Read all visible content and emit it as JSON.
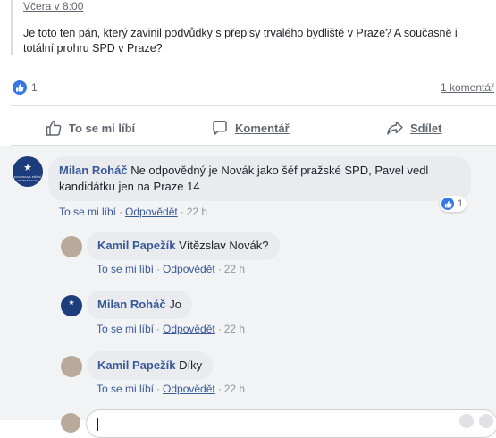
{
  "post": {
    "time": "Včera v 8:00",
    "text": "Je toto ten pán, který zavinil podvůdky s přepisy trvalého bydliště v Praze? A současně i totální prohru SPD v Praze?"
  },
  "reactions": {
    "likes": "1",
    "comments": "1 komentář"
  },
  "actions": {
    "like": "To se mi líbí",
    "comment": "Komentář",
    "share": "Sdílet"
  },
  "avatar_text": {
    "star": "★",
    "spd": "SVOBODA A PŘÍMÁ DEMOKRACIE"
  },
  "comments": [
    {
      "author": "Milan Roháč",
      "text": "Ne odpovědný je Novák jako šéf pražské SPD, Pavel vedl kandidátku jen na Praze 14",
      "like": "To se mi líbí",
      "reply": "Odpovědět",
      "time": "22 h",
      "reaction_count": "1"
    },
    {
      "author": "Kamil Papežík",
      "text": "Vítězslav Novák?",
      "like": "To se mi líbí",
      "reply": "Odpovědět",
      "time": "22 h"
    },
    {
      "author": "Milan Roháč",
      "text": "Jo",
      "like": "To se mi líbí",
      "reply": "Odpovědět",
      "time": "22 h"
    },
    {
      "author": "Kamil Papežík",
      "text": "Díky",
      "like": "To se mi líbí",
      "reply": "Odpovědět",
      "time": "22 h"
    }
  ],
  "colors": {
    "link": "#385898",
    "like_blue": "#3578e5",
    "spd_blue": "#1d3c7b",
    "bubble": "#e9ebee",
    "background": "#f2f3f5"
  },
  "icons": {
    "like": "thumbs-up-icon",
    "comment": "speech-bubble-icon",
    "share": "share-arrow-icon"
  }
}
